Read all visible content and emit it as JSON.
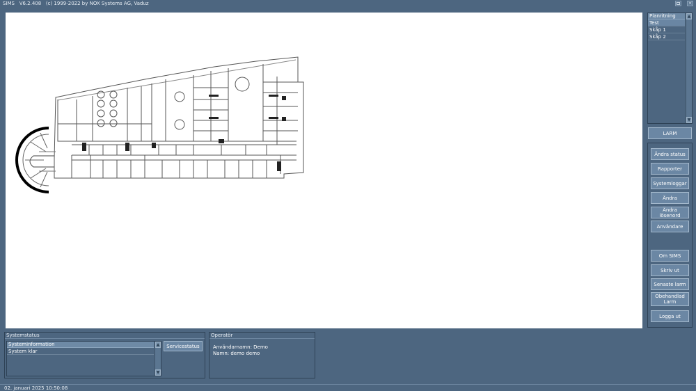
{
  "window": {
    "app_name": "SIMS",
    "version": "V6.2.408",
    "copyright": "(c) 1999-2022 by NOX Systems AG, Vaduz"
  },
  "floorplans": {
    "header": "Planritning",
    "items": [
      {
        "label": "Test",
        "selected": true
      },
      {
        "label": "Skåp 1",
        "selected": false
      },
      {
        "label": "Skåp 2",
        "selected": false
      }
    ]
  },
  "alarm_button": "LARM",
  "actions": {
    "change_status": "Ändra status",
    "reports": "Rapporter",
    "system_logs": "Systemloggar",
    "change": "Ändra",
    "change_password": "Ändra lösenord",
    "users": "Användare",
    "about": "Om SIMS",
    "print": "Skriv ut",
    "latest_alarm": "Senaste larm",
    "unhandled_alarm": "Obehandlad Larm",
    "logout": "Logga ut"
  },
  "system_status": {
    "title": "Systemstatus",
    "list_header": "Systeminformation",
    "items": [
      "System klar"
    ],
    "service_button": "Servicestatus"
  },
  "operator": {
    "title": "Operatör",
    "username_line": "Användarnamn: Demo",
    "name_line": "Namn: demo demo"
  },
  "status_bar": {
    "datetime": "02. januari 2025   10:50:08"
  }
}
